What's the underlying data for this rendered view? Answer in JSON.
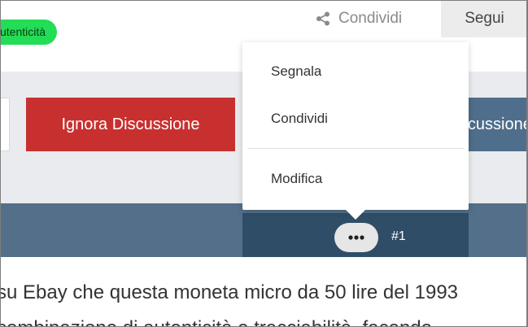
{
  "topbar": {
    "badge_label": "utenticità",
    "share_label": "Condividi",
    "follow_label": "Segui"
  },
  "actions": {
    "ignore_label": "Ignora Discussione",
    "follow_discussion_label": "Discussione"
  },
  "post": {
    "number": "#1"
  },
  "dropdown": {
    "items": [
      "Segnala",
      "Condividi",
      "Modifica"
    ]
  },
  "content": {
    "line1": "su Ebay che questa moneta micro da 50 lire del 1993 ",
    "line2": "combinazione di autenticità e tracciabilità, facendo"
  },
  "colors": {
    "badge": "#22dd55",
    "ignore_button": "#c8302f",
    "post_bar": "#536f89",
    "post_bar_dark": "#2f4d66"
  }
}
